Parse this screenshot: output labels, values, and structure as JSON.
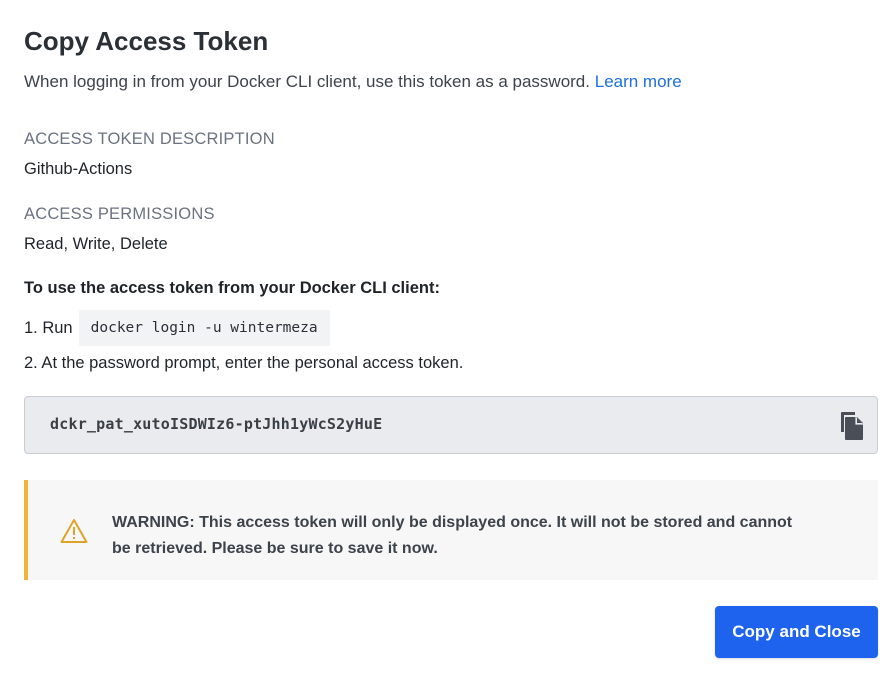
{
  "dialog": {
    "title": "Copy Access Token",
    "subtitle": "When logging in from your Docker CLI client, use this token as a password.",
    "learn_more": "Learn more"
  },
  "fields": {
    "description_label": "ACCESS TOKEN DESCRIPTION",
    "description_value": "Github-Actions",
    "permissions_label": "ACCESS PERMISSIONS",
    "permissions_value": "Read, Write, Delete"
  },
  "instructions": {
    "heading": "To use the access token from your Docker CLI client:",
    "step1_prefix": "1. Run",
    "step1_command": "docker login -u wintermeza",
    "step2": "2. At the password prompt, enter the personal access token."
  },
  "token": {
    "value": "dckr_pat_xutoISDWIz6-ptJhh1yWcS2yHuE",
    "copy_icon": "copy-icon"
  },
  "warning": {
    "icon": "warning-triangle-icon",
    "text": "WARNING: This access token will only be displayed once. It will not be stored and cannot be retrieved. Please be sure to save it now."
  },
  "actions": {
    "copy_and_close": "Copy and Close"
  },
  "colors": {
    "primary": "#1d63ed",
    "link": "#1d70e0",
    "warning_accent": "#f2b33b"
  }
}
